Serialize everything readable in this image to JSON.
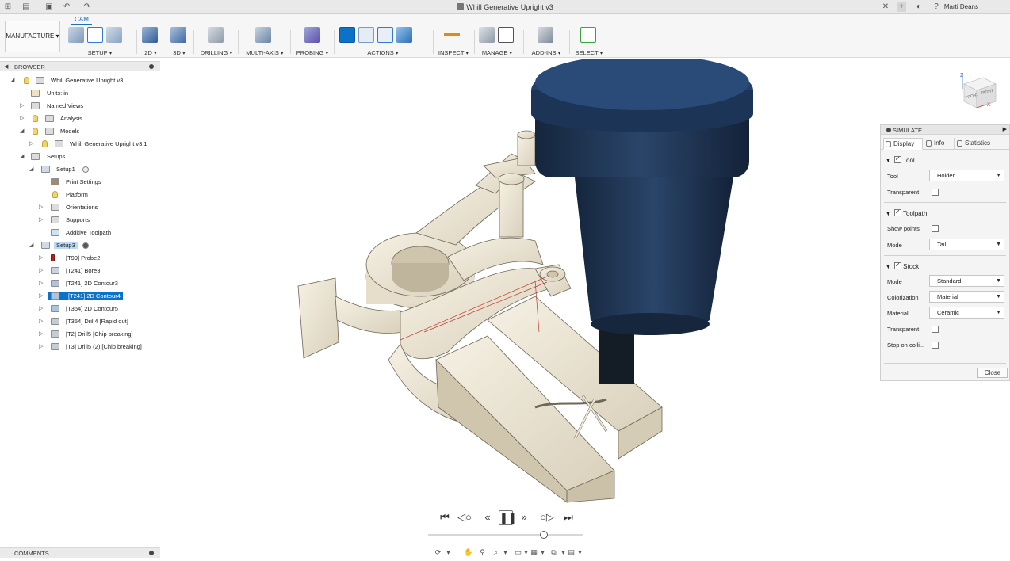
{
  "window": {
    "title": "Whill Generative Upright v3",
    "user": "Marti Deans",
    "icons": [
      "app-grid-icon",
      "file-icon",
      "save-icon",
      "undo-icon",
      "redo-icon",
      "close-icon",
      "new-tab-icon",
      "jobs-icon",
      "help-icon"
    ]
  },
  "ribbon": {
    "active_tab": "CAM",
    "workspace": "MANUFACTURE",
    "groups": [
      {
        "label": "SETUP ▾"
      },
      {
        "label": "2D ▾"
      },
      {
        "label": "3D ▾"
      },
      {
        "label": "DRILLING ▾"
      },
      {
        "label": "MULTI-AXIS ▾"
      },
      {
        "label": "PROBING ▾"
      },
      {
        "label": "ACTIONS ▾"
      },
      {
        "label": "INSPECT ▾"
      },
      {
        "label": "MANAGE ▾"
      },
      {
        "label": "ADD-INS ▾"
      },
      {
        "label": "SELECT ▾"
      }
    ]
  },
  "browser": {
    "title": "BROWSER",
    "items": [
      {
        "label": "Whill Generative Upright v3"
      },
      {
        "label": "Units: in"
      },
      {
        "label": "Named Views"
      },
      {
        "label": "Analysis"
      },
      {
        "label": "Models"
      },
      {
        "label": "Whill Generative Upright v3:1"
      },
      {
        "label": "Setups"
      },
      {
        "label": "Setup1"
      },
      {
        "label": "Print Settings"
      },
      {
        "label": "Platform"
      },
      {
        "label": "Orientations"
      },
      {
        "label": "Supports"
      },
      {
        "label": "Additive Toolpath"
      },
      {
        "label": "Setup3"
      },
      {
        "label": "[T99] Probe2"
      },
      {
        "label": "[T241] Bore3"
      },
      {
        "label": "[T241] 2D Contour3"
      },
      {
        "label": "[T241] 2D Contour4"
      },
      {
        "label": "[T354] 2D Contour5"
      },
      {
        "label": "[T354] Drill4 [Rapid out]"
      },
      {
        "label": "[T2] Drill5 [Chip breaking]"
      },
      {
        "label": "[T3] Drill5 (2) [Chip breaking]"
      }
    ]
  },
  "comments": {
    "title": "COMMENTS"
  },
  "viewcube": {
    "front": "FRONT",
    "right": "RIGHT",
    "axis_z": "Z",
    "axis_x": "X"
  },
  "simulate": {
    "title": "SIMULATE",
    "tabs": [
      "Display",
      "Info",
      "Statistics"
    ],
    "tool_section": {
      "title": "Tool",
      "tool_label": "Tool",
      "tool_value": "Holder",
      "transparent_label": "Transparent"
    },
    "toolpath_section": {
      "title": "Toolpath",
      "show_points_label": "Show points",
      "mode_label": "Mode",
      "mode_value": "Tail"
    },
    "stock_section": {
      "title": "Stock",
      "mode_label": "Mode",
      "mode_value": "Standard",
      "colorization_label": "Colorization",
      "colorization_value": "Material",
      "material_label": "Material",
      "material_value": "Ceramic",
      "transparent_label": "Transparent",
      "stop_label": "Stop on colli..."
    },
    "close_label": "Close"
  },
  "player": {
    "buttons": [
      "skip-to-start-icon",
      "previous-operation-icon",
      "step-back-icon",
      "play-pause-icon",
      "step-forward-icon",
      "next-operation-icon",
      "skip-to-end-icon"
    ],
    "progress": 0.76
  },
  "colors": {
    "accent": "#0a72c9",
    "part": "#ece5d3",
    "holder": "#1e3350",
    "toolpath": "#c0392b"
  }
}
